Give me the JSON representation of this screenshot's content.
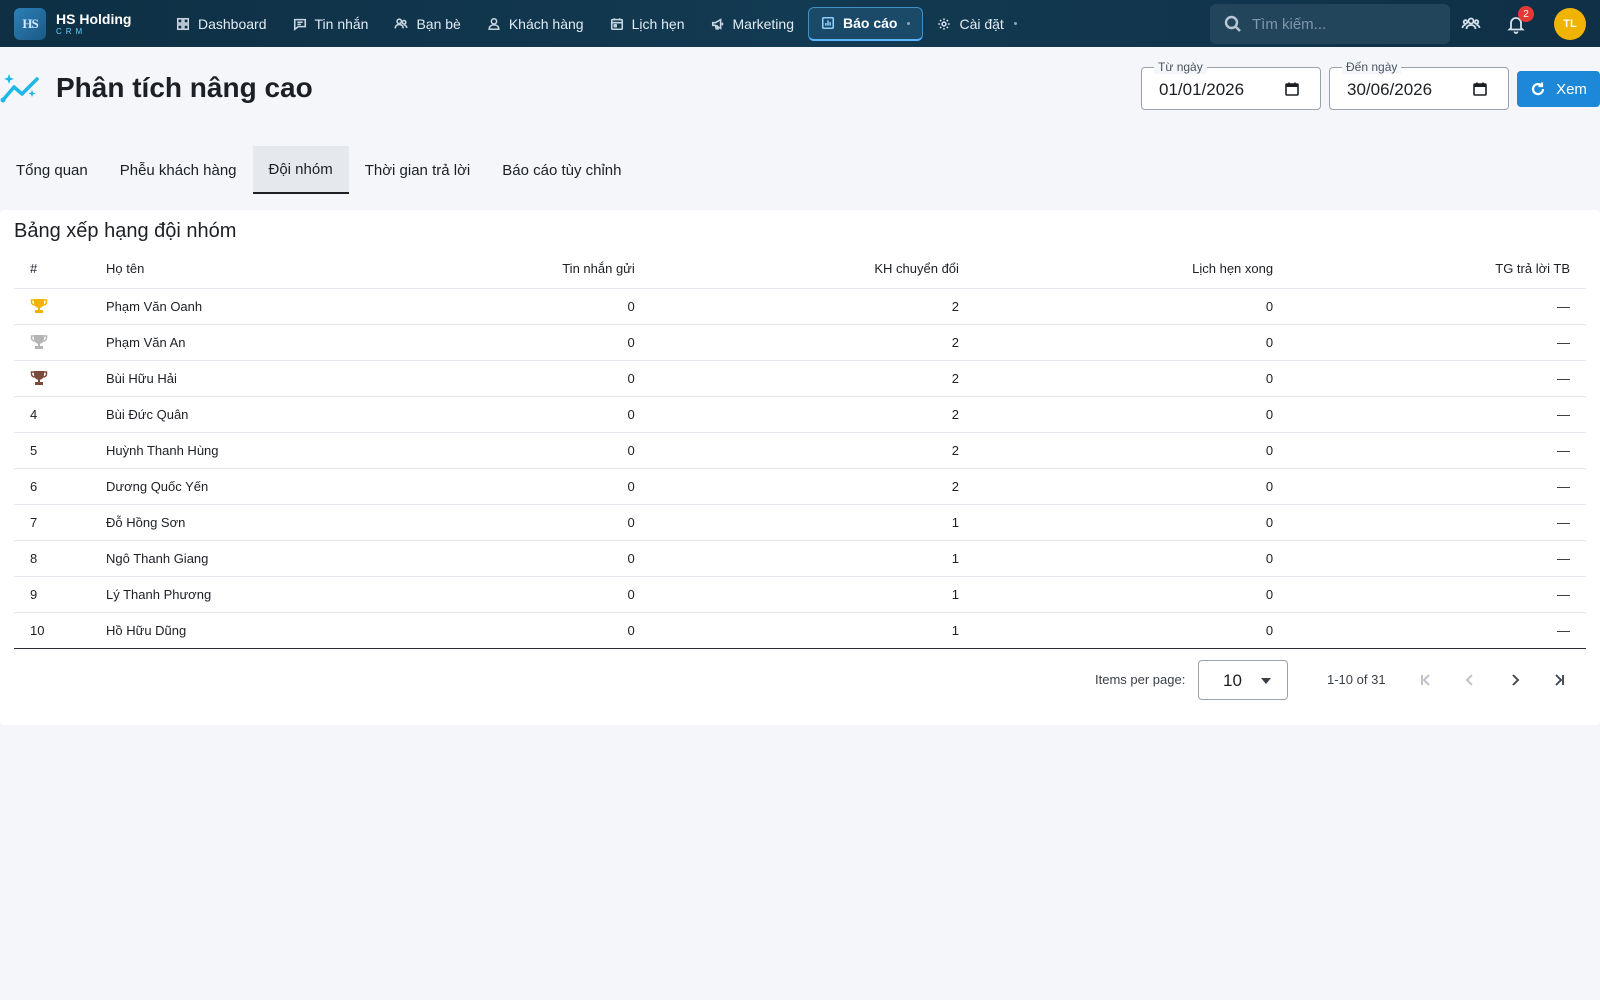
{
  "brand": {
    "logo_text": "HS",
    "name": "HS Holding",
    "sub": "CRM"
  },
  "nav": {
    "items": [
      {
        "label": "Dashboard",
        "icon": "grid-icon"
      },
      {
        "label": "Tin nhắn",
        "icon": "message-icon"
      },
      {
        "label": "Bạn bè",
        "icon": "friends-icon"
      },
      {
        "label": "Khách hàng",
        "icon": "customer-icon"
      },
      {
        "label": "Lịch hẹn",
        "icon": "calendar-icon"
      },
      {
        "label": "Marketing",
        "icon": "megaphone-icon"
      },
      {
        "label": "Báo cáo",
        "icon": "chart-icon",
        "active": true
      },
      {
        "label": "Cài đặt",
        "icon": "gear-icon"
      }
    ]
  },
  "search": {
    "placeholder": "Tìm kiếm..."
  },
  "notifications": {
    "count": "2"
  },
  "user": {
    "initials": "TL"
  },
  "page": {
    "title": "Phân tích nâng cao"
  },
  "filters": {
    "from_label": "Từ ngày",
    "from_value": "01/01/2026",
    "to_label": "Đến ngày",
    "to_value": "30/06/2026",
    "view_label": "Xem"
  },
  "tabs": [
    {
      "label": "Tổng quan"
    },
    {
      "label": "Phễu khách hàng"
    },
    {
      "label": "Đội nhóm",
      "active": true
    },
    {
      "label": "Thời gian trả lời"
    },
    {
      "label": "Báo cáo tùy chỉnh"
    }
  ],
  "leaderboard": {
    "title": "Bảng xếp hạng đội nhóm",
    "columns": [
      "#",
      "Họ tên",
      "Tin nhắn gửi",
      "KH chuyển đổi",
      "Lịch hẹn xong",
      "TG trả lời TB"
    ],
    "rows": [
      {
        "rank": "1",
        "trophy": "gold-trophy-icon",
        "name": "Phạm Văn Oanh",
        "messages": "0",
        "converted": "2",
        "appointments": "0",
        "avg_response": "—"
      },
      {
        "rank": "2",
        "trophy": "silver-trophy-icon",
        "name": "Phạm Văn An",
        "messages": "0",
        "converted": "2",
        "appointments": "0",
        "avg_response": "—"
      },
      {
        "rank": "3",
        "trophy": "bronze-trophy-icon",
        "name": "Bùi Hữu Hải",
        "messages": "0",
        "converted": "2",
        "appointments": "0",
        "avg_response": "—"
      },
      {
        "rank": "4",
        "name": "Bùi Đức Quân",
        "messages": "0",
        "converted": "2",
        "appointments": "0",
        "avg_response": "—"
      },
      {
        "rank": "5",
        "name": "Huỳnh Thanh Hùng",
        "messages": "0",
        "converted": "2",
        "appointments": "0",
        "avg_response": "—"
      },
      {
        "rank": "6",
        "name": "Dương Quốc Yến",
        "messages": "0",
        "converted": "2",
        "appointments": "0",
        "avg_response": "—"
      },
      {
        "rank": "7",
        "name": "Đỗ Hồng Sơn",
        "messages": "0",
        "converted": "1",
        "appointments": "0",
        "avg_response": "—"
      },
      {
        "rank": "8",
        "name": "Ngô Thanh Giang",
        "messages": "0",
        "converted": "1",
        "appointments": "0",
        "avg_response": "—"
      },
      {
        "rank": "9",
        "name": "Lý Thanh Phương",
        "messages": "0",
        "converted": "1",
        "appointments": "0",
        "avg_response": "—"
      },
      {
        "rank": "10",
        "name": "Hồ Hữu Dũng",
        "messages": "0",
        "converted": "1",
        "appointments": "0",
        "avg_response": "—"
      }
    ]
  },
  "pagination": {
    "items_per_page_label": "Items per page:",
    "items_per_page": "10",
    "range": "1-10 of 31"
  },
  "colors": {
    "nav_bg": "#0e2f44",
    "accent": "#1e88d8",
    "gold": "#f2b200",
    "silver": "#b5b5b5",
    "bronze": "#7a4a3a",
    "badge": "#e53935"
  }
}
